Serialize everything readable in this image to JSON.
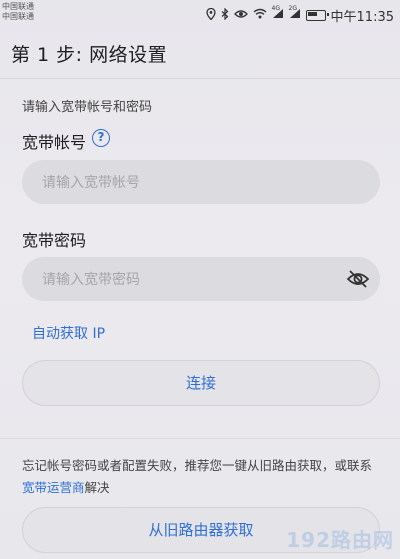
{
  "status_bar": {
    "carrier_1": "中国联通",
    "carrier_2": "中国联通",
    "signal_1": "4G",
    "signal_2": "2G",
    "time": "中午11:35",
    "icons": [
      "location-icon",
      "bluetooth-icon",
      "eye-icon",
      "wifi-icon",
      "signal-icon",
      "battery-icon"
    ]
  },
  "header": {
    "title": "第 1 步: 网络设置"
  },
  "form": {
    "hint": "请输入宽带帐号和密码",
    "account_label": "宽带帐号",
    "account_placeholder": "请输入宽带帐号",
    "account_value": "",
    "password_label": "宽带密码",
    "password_placeholder": "请输入宽带密码",
    "password_value": "",
    "help_symbol": "?",
    "auto_ip_link": "自动获取 IP",
    "connect_button": "连接"
  },
  "footer": {
    "forgot_text_part1": "忘记帐号密码或者配置失败，推荐您一键从旧路由获取，或联系",
    "isp_link": "宽带运营商",
    "forgot_text_part2": "解决",
    "old_router_button": "从旧路由器获取"
  },
  "watermark": "192路由网",
  "colors": {
    "accent": "#2f6fd6",
    "background": "#e9e8ed",
    "input_bg": "#dcdbe0"
  }
}
